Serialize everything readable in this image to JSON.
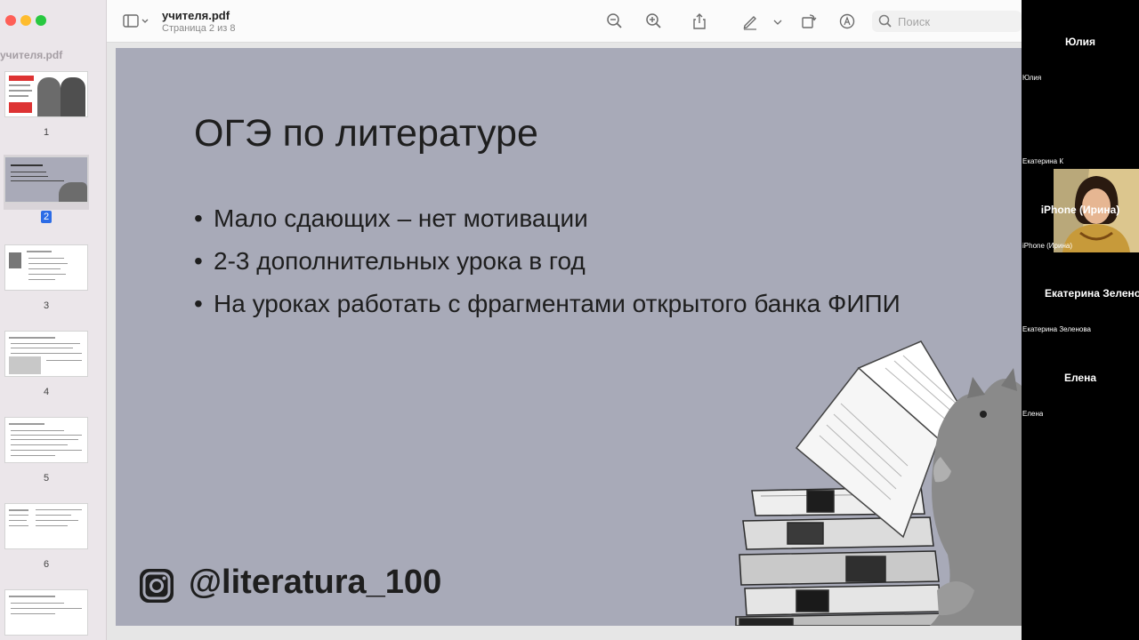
{
  "window": {
    "sidebar_title": "учителя.pdf",
    "doc_title": "учителя.pdf",
    "doc_subtitle": "Страница 2 из 8",
    "search_placeholder": "Поиск"
  },
  "thumbnails": [
    {
      "num": "1",
      "selected": false
    },
    {
      "num": "2",
      "selected": true
    },
    {
      "num": "3",
      "selected": false
    },
    {
      "num": "4",
      "selected": false
    },
    {
      "num": "5",
      "selected": false
    },
    {
      "num": "6",
      "selected": false
    },
    {
      "num": "",
      "selected": false
    }
  ],
  "slide": {
    "title": "ОГЭ по литературе",
    "bullets": [
      "Мало сдающих – нет мотивации",
      "2-3 дополнительных урока в год",
      "На уроках работать с фрагментами открытого банка ФИПИ"
    ],
    "bullet_mark": "•",
    "handle": "@literatura_100"
  },
  "participants": [
    {
      "name": "Юлия",
      "label": "Юлия",
      "video": false
    },
    {
      "name": "",
      "label": "Екатерина К",
      "video": true
    },
    {
      "name": "iPhone (Ирина)",
      "label": "iPhone (Ирина)",
      "video": false
    },
    {
      "name": "Екатерина Зеленова",
      "label": "Екатерина Зеленова",
      "video": false
    },
    {
      "name": "Елена",
      "label": "Елена",
      "video": false
    }
  ],
  "icons": {
    "sidebar_toggle": "sidebar-icon",
    "zoom_out": "zoom-out-icon",
    "zoom_in": "zoom-in-icon",
    "share": "share-icon",
    "markup": "pencil-icon",
    "rotate": "rotate-icon",
    "annotate": "annotate-icon",
    "search": "search-icon",
    "instagram": "instagram-icon"
  },
  "colors": {
    "slide_bg": "#a8aab8",
    "selected_page": "#2c6ce6"
  }
}
